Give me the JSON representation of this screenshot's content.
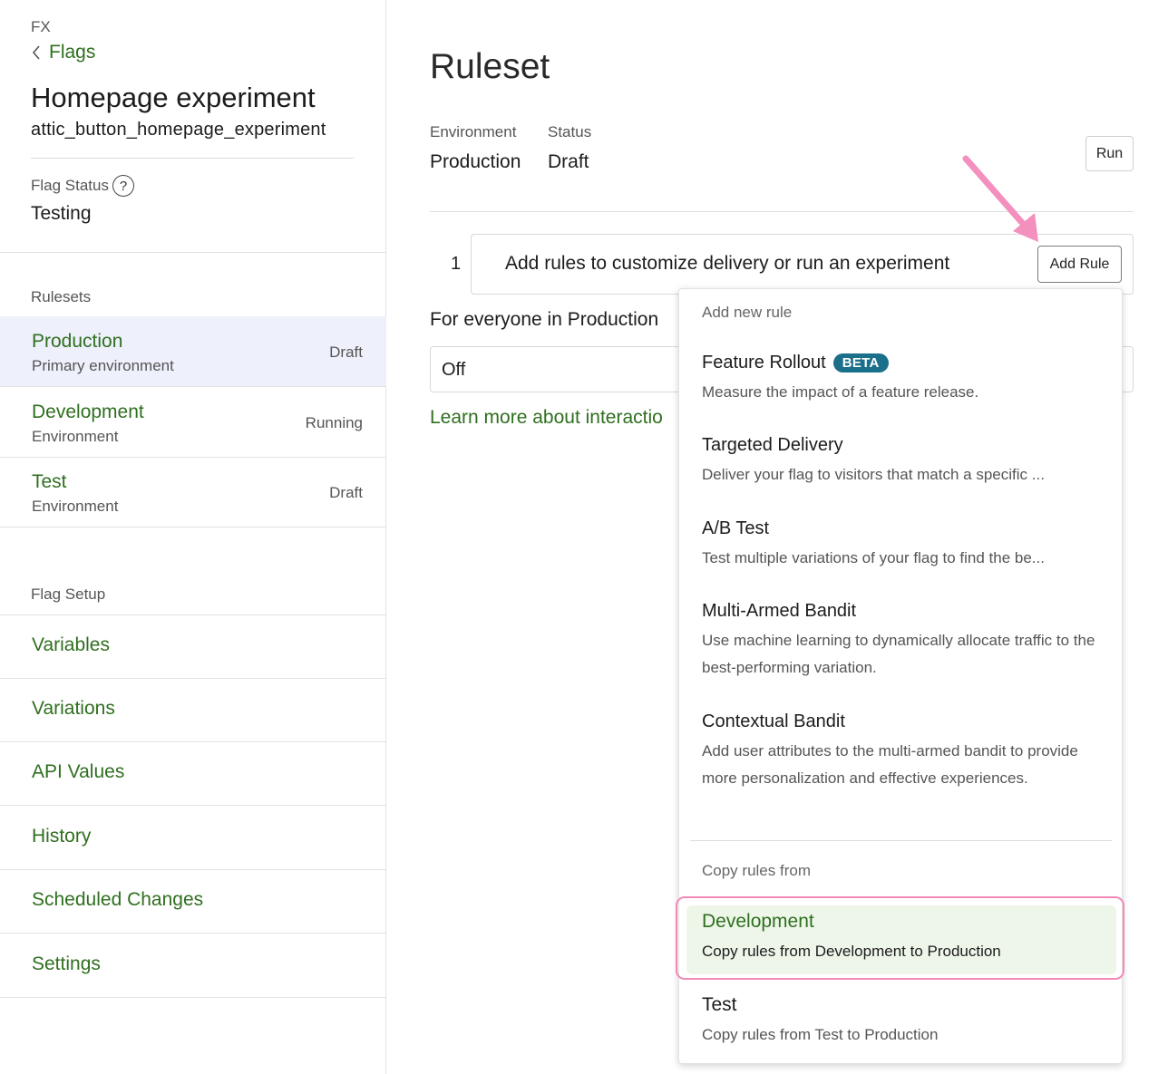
{
  "sidebar": {
    "app_label": "FX",
    "back_label": "Flags",
    "flag_name": "Homepage experiment",
    "flag_key": "attic_button_homepage_experiment",
    "flag_status_label": "Flag Status",
    "flag_status_help": "?",
    "flag_status_value": "Testing",
    "rulesets_label": "Rulesets",
    "environments": [
      {
        "name": "Production",
        "sub": "Primary environment",
        "status": "Draft"
      },
      {
        "name": "Development",
        "sub": "Environment",
        "status": "Running"
      },
      {
        "name": "Test",
        "sub": "Environment",
        "status": "Draft"
      }
    ],
    "setup_label": "Flag Setup",
    "setup_items": [
      "Variables",
      "Variations",
      "API Values",
      "History",
      "Scheduled Changes",
      "Settings"
    ]
  },
  "main": {
    "title": "Ruleset",
    "environment_label": "Environment",
    "environment_value": "Production",
    "status_label": "Status",
    "status_value": "Draft",
    "run_label": "Run",
    "rule_number": "1",
    "rule_prompt": "Add rules to customize delivery or run an experiment",
    "add_rule_label": "Add Rule",
    "everyone_label": "For everyone in Production",
    "off_value": "Off",
    "learn_more": "Learn more about interactio"
  },
  "dropdown": {
    "new_rule_header": "Add new rule",
    "rules": [
      {
        "title": "Feature Rollout",
        "badge": "BETA",
        "desc": "Measure the impact of a feature release."
      },
      {
        "title": "Targeted Delivery",
        "desc": "Deliver your flag to visitors that match a specific ..."
      },
      {
        "title": "A/B Test",
        "desc": "Test multiple variations of your flag to find the be..."
      },
      {
        "title": "Multi-Armed Bandit",
        "desc": "Use machine learning to dynamically allocate traffic to the best-performing variation."
      },
      {
        "title": "Contextual Bandit",
        "desc": "Add user attributes to the multi-armed bandit to provide more personalization and effective experiences."
      }
    ],
    "copy_header": "Copy rules from",
    "copy_items": [
      {
        "title": "Development",
        "desc": "Copy rules from Development to Production"
      },
      {
        "title": "Test",
        "desc": "Copy rules from Test to Production"
      }
    ]
  },
  "colors": {
    "link_green": "#2f6f1f",
    "active_row": "#eef0fb",
    "beta_badge": "#1a6f8a",
    "annotation_pink": "#f28ab8",
    "copy_highlight": "#eef6ea"
  }
}
